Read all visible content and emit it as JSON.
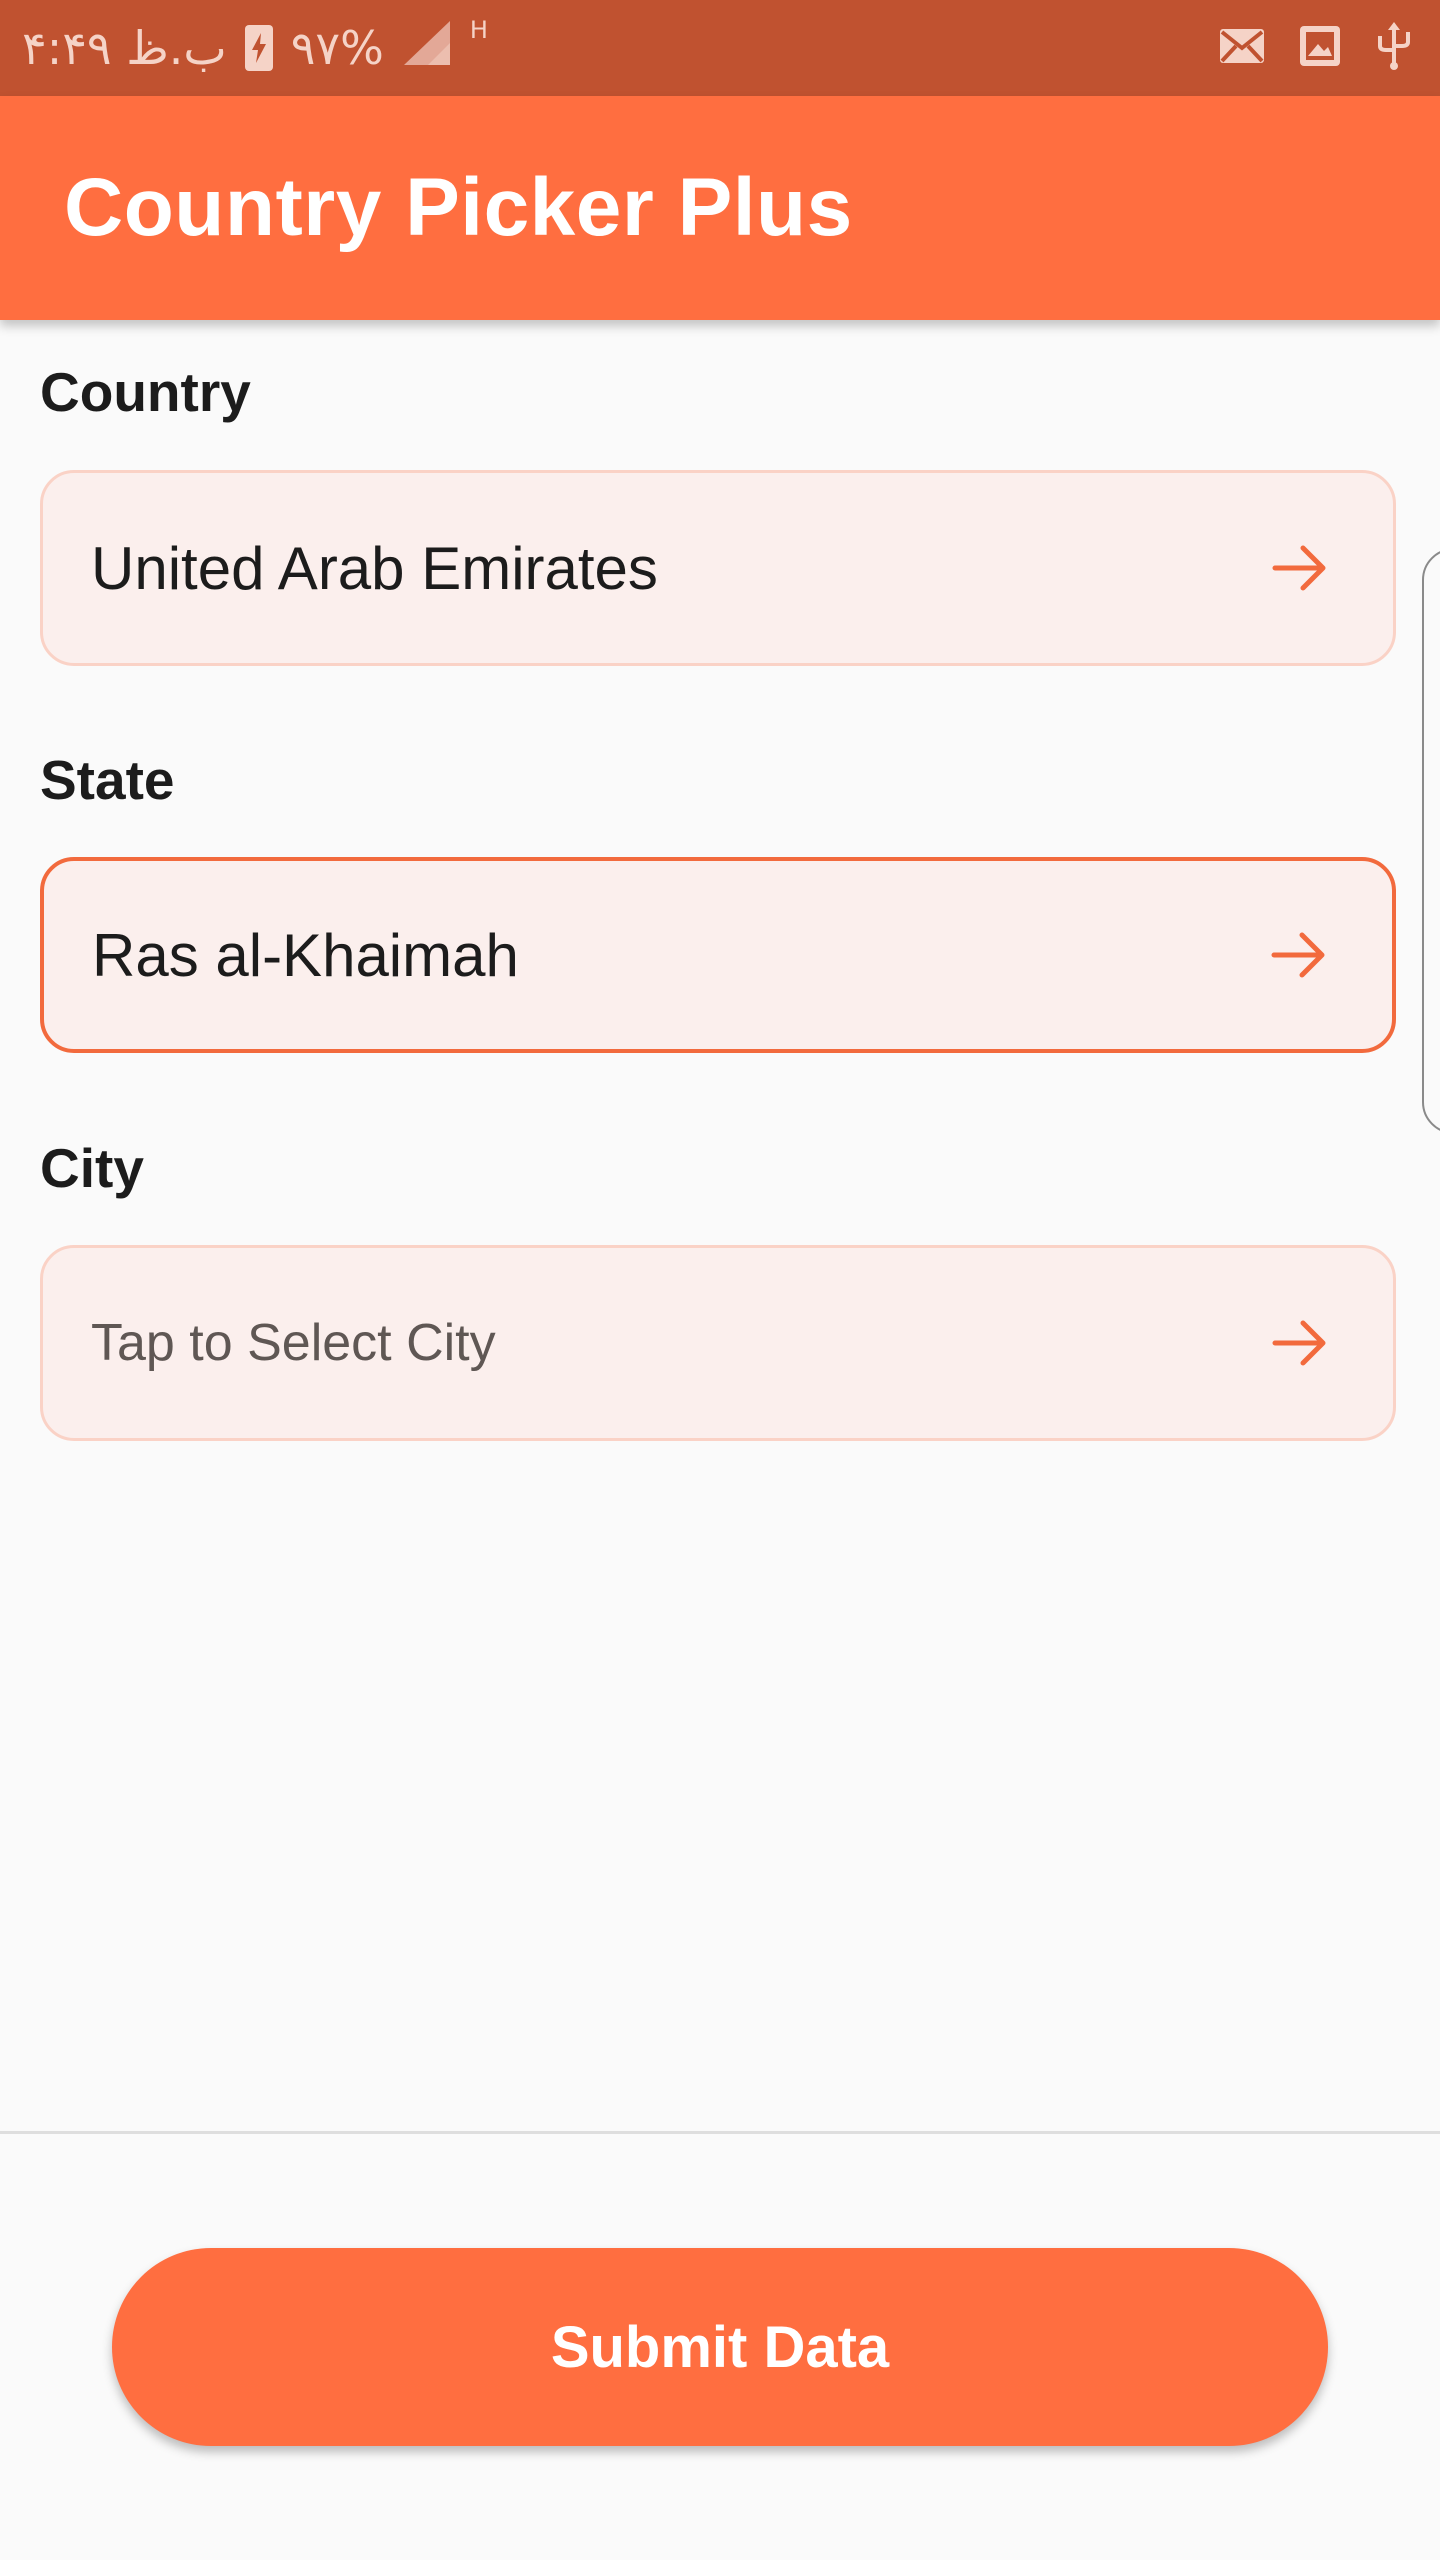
{
  "status_bar": {
    "time": "ب.ظ ۴:۴۹",
    "battery": "۹۷%",
    "network": "H",
    "icons": [
      "battery-charging-icon",
      "signal-icon",
      "mail-icon",
      "image-icon",
      "usb-icon"
    ]
  },
  "app_bar": {
    "title": "Country Picker Plus",
    "color": "#ff6e40"
  },
  "form": {
    "country": {
      "label": "Country",
      "value": "United Arab Emirates",
      "icon": "arrow-forward-icon"
    },
    "state": {
      "label": "State",
      "value": "Ras al-Khaimah",
      "icon": "arrow-forward-icon",
      "focused": true
    },
    "city": {
      "label": "City",
      "placeholder": "Tap to Select City",
      "icon": "arrow-forward-icon"
    }
  },
  "submit": {
    "label": "Submit Data"
  },
  "colors": {
    "accent": "#ff6e40",
    "status_bar": "#c05230",
    "field_background": "#fbefed",
    "field_border": "#fad2c6",
    "focused_border": "#f26a3d"
  }
}
